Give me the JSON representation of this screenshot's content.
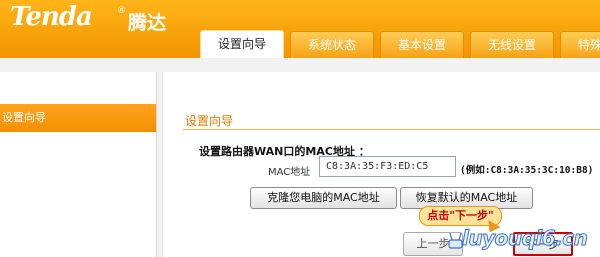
{
  "brand": {
    "logo": "Tenda",
    "registered": "®",
    "logo_cn": "腾达"
  },
  "tabs": [
    {
      "label": "设置向导",
      "active": true
    },
    {
      "label": "系统状态",
      "active": false
    },
    {
      "label": "基本设置",
      "active": false
    },
    {
      "label": "无线设置",
      "active": false
    },
    {
      "label": "特殊",
      "active": false
    }
  ],
  "sidebar": {
    "items": [
      {
        "label": "设置向导",
        "active": true
      }
    ]
  },
  "main": {
    "section_title": "设置向导",
    "mac_heading": "设置路由器WAN口的MAC地址 ：",
    "mac_label": "MAC地址",
    "mac_value": "C8:3A:35:F3:ED:C5",
    "mac_example": "(例如:C8:3A:35:3C:10:B8)",
    "clone_button": "克隆您电脑的MAC地址",
    "restore_button": "恢复默认的MAC地址",
    "callout": "点击\"下一步\"",
    "prev_button": "上一步",
    "next_button": "下一步"
  },
  "watermark": {
    "text": "luyouqi6.cn"
  },
  "colors": {
    "header_orange": "#f7a21b",
    "accent": "#e87a00",
    "highlight_red": "#d00000"
  }
}
